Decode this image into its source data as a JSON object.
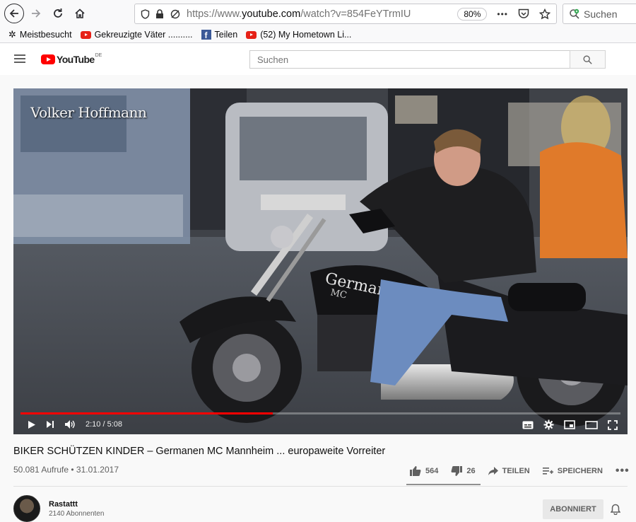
{
  "browser": {
    "url_prefix": "https://www.",
    "url_domain": "youtube.com",
    "url_path": "/watch?v=854FeYTrmIU",
    "zoom": "80%",
    "menu_dots": "•••",
    "search_placeholder": "Suchen"
  },
  "bookmarks": [
    {
      "label": "Meistbesucht",
      "icon": "gear-icon"
    },
    {
      "label": "Gekreuzigte Väter ..........",
      "icon": "youtube-icon"
    },
    {
      "label": "Teilen",
      "icon": "facebook-icon"
    },
    {
      "label": "(52) My Hometown Li...",
      "icon": "youtube-icon"
    }
  ],
  "youtube": {
    "logo_text": "YouTube",
    "logo_region": "DE",
    "search_placeholder": "Suchen"
  },
  "video": {
    "watermark": "Volker Hoffmann",
    "current_time": "2:10",
    "duration": "5:08",
    "time_display": "2:10 / 5:08",
    "progress_fraction": 0.42
  },
  "meta": {
    "title": "BIKER SCHÜTZEN KINDER – Germanen MC Mannheim ... europaweite Vorreiter",
    "views_date": "50.081 Aufrufe • 31.01.2017",
    "likes": "564",
    "dislikes": "26",
    "share_label": "TEILEN",
    "save_label": "SPEICHERN",
    "more": "•••"
  },
  "channel": {
    "name": "Rastattt",
    "subscribers": "2140 Abonnenten",
    "subscribe_label": "ABONNIERT"
  }
}
